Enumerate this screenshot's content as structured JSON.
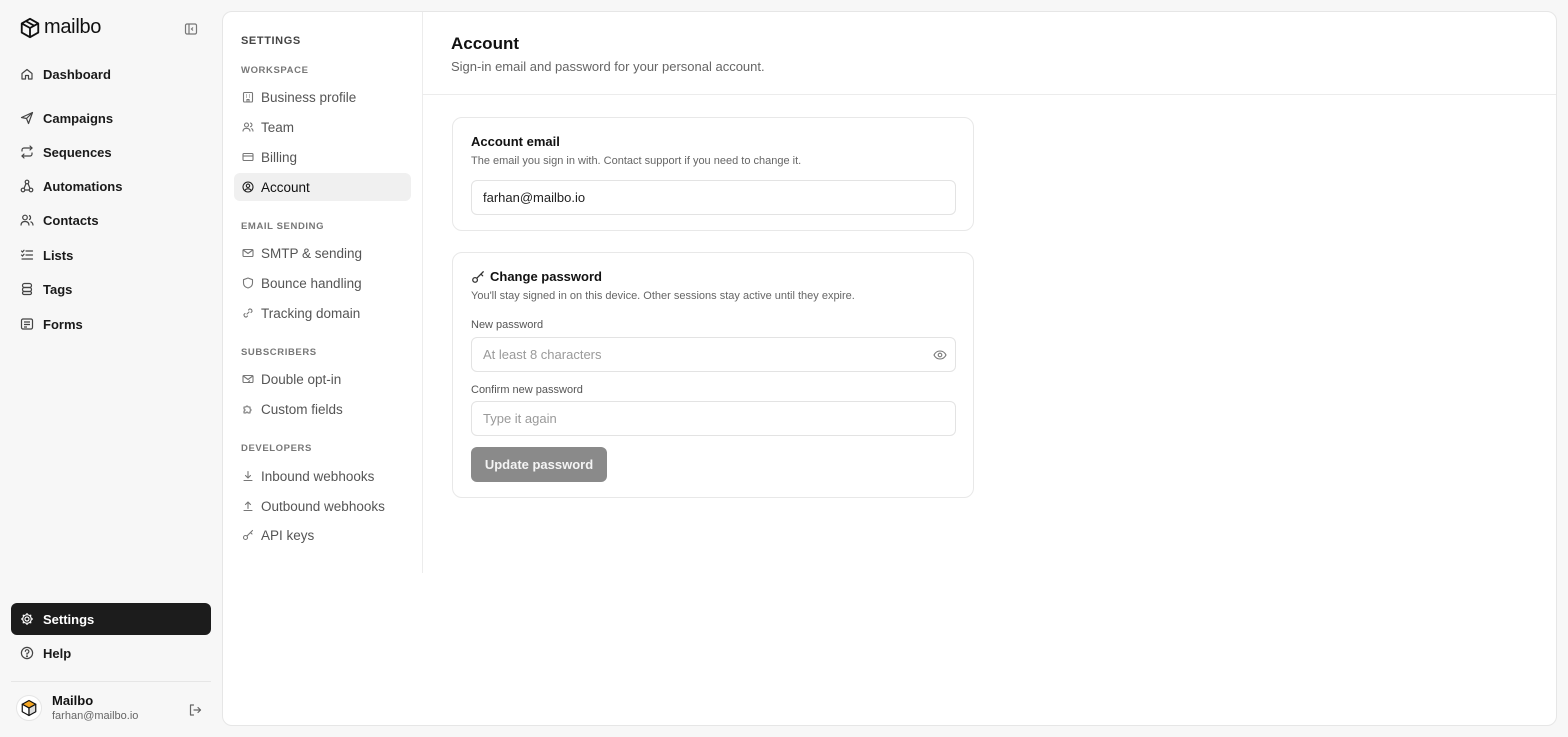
{
  "brand": {
    "name": "mailbo"
  },
  "sidebar": {
    "items": [
      {
        "label": "Dashboard",
        "icon": "home-icon"
      },
      {
        "label": "Campaigns",
        "icon": "send-icon"
      },
      {
        "label": "Sequences",
        "icon": "repeat-icon"
      },
      {
        "label": "Automations",
        "icon": "workflow-icon"
      },
      {
        "label": "Contacts",
        "icon": "users-icon"
      },
      {
        "label": "Lists",
        "icon": "list-icon"
      },
      {
        "label": "Tags",
        "icon": "tags-icon"
      },
      {
        "label": "Forms",
        "icon": "form-icon"
      }
    ],
    "bottom": [
      {
        "label": "Settings",
        "icon": "gear-icon",
        "active": true
      },
      {
        "label": "Help",
        "icon": "help-icon"
      }
    ],
    "user": {
      "name": "Mailbo",
      "email": "farhan@mailbo.io"
    }
  },
  "settings_nav": {
    "title": "SETTINGS",
    "sections": [
      {
        "label": "WORKSPACE",
        "items": [
          {
            "label": "Business profile",
            "icon": "building-icon"
          },
          {
            "label": "Team",
            "icon": "users-icon"
          },
          {
            "label": "Billing",
            "icon": "credit-card-icon"
          },
          {
            "label": "Account",
            "icon": "user-circle-icon",
            "active": true
          }
        ]
      },
      {
        "label": "EMAIL SENDING",
        "items": [
          {
            "label": "SMTP & sending",
            "icon": "mail-icon"
          },
          {
            "label": "Bounce handling",
            "icon": "shield-icon"
          },
          {
            "label": "Tracking domain",
            "icon": "link-icon"
          }
        ]
      },
      {
        "label": "SUBSCRIBERS",
        "items": [
          {
            "label": "Double opt-in",
            "icon": "mail-open-icon"
          },
          {
            "label": "Custom fields",
            "icon": "puzzle-icon"
          }
        ]
      },
      {
        "label": "DEVELOPERS",
        "items": [
          {
            "label": "Inbound webhooks",
            "icon": "download-icon"
          },
          {
            "label": "Outbound webhooks",
            "icon": "upload-icon"
          },
          {
            "label": "API keys",
            "icon": "key-icon"
          }
        ]
      }
    ]
  },
  "page": {
    "title": "Account",
    "subtitle": "Sign-in email and password for your personal account."
  },
  "account_email": {
    "title": "Account email",
    "description": "The email you sign in with. Contact support if you need to change it.",
    "value": "farhan@mailbo.io"
  },
  "change_password": {
    "title": "Change password",
    "description": "You'll stay signed in on this device. Other sessions stay active until they expire.",
    "new_label": "New password",
    "new_placeholder": "At least 8 characters",
    "confirm_label": "Confirm new password",
    "confirm_placeholder": "Type it again",
    "button_label": "Update password"
  },
  "colors": {
    "active_nav": "#1c1c1c",
    "disabled_button": "#8a8a8a"
  }
}
